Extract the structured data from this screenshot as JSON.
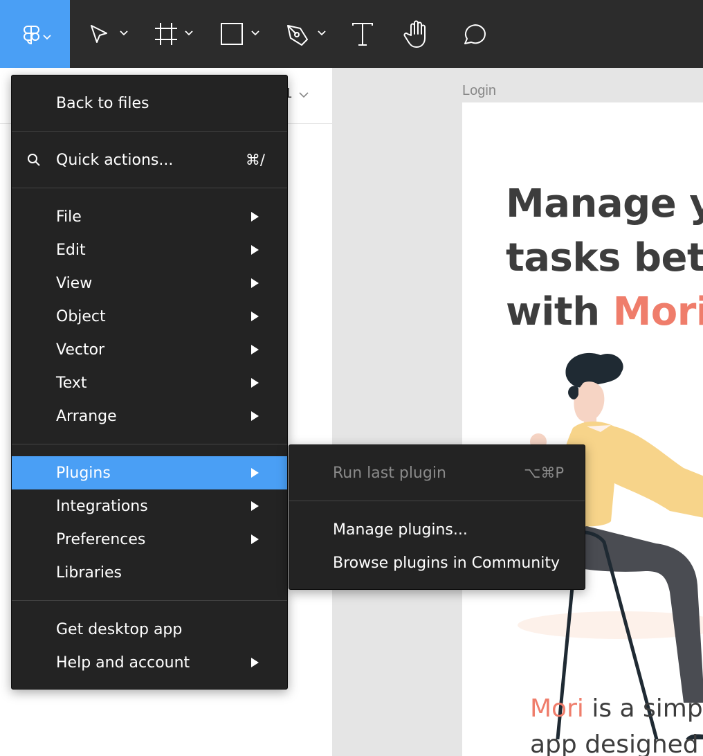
{
  "toolbar": {
    "tools": [
      {
        "name": "figma-menu",
        "icon": "figma-logo-icon"
      },
      {
        "name": "move-tool",
        "icon": "pointer-icon"
      },
      {
        "name": "frame-tool",
        "icon": "frame-icon"
      },
      {
        "name": "shape-tool",
        "icon": "rectangle-icon"
      },
      {
        "name": "pen-tool",
        "icon": "pen-icon"
      },
      {
        "name": "text-tool",
        "icon": "text-icon"
      },
      {
        "name": "hand-tool",
        "icon": "hand-icon"
      },
      {
        "name": "comment-tool",
        "icon": "comment-icon"
      }
    ],
    "accent": "#4a9ff5",
    "background": "#2c2c2c"
  },
  "left_panel": {
    "page_label_partial": "1"
  },
  "canvas": {
    "frame_label": "Login",
    "headline_line1": "Manage yo",
    "headline_line2": "tasks bett",
    "headline_line3_prefix": "with ",
    "headline_line3_accent": "Mori",
    "body_line1_accent": "Mori",
    "body_line1_rest": " is a simp",
    "body_line2": "app designed",
    "accent_color": "#ef7d6b"
  },
  "menu": {
    "back_to_files": "Back to files",
    "quick_actions": "Quick actions...",
    "quick_actions_shortcut": "⌘/",
    "file": "File",
    "edit": "Edit",
    "view": "View",
    "object": "Object",
    "vector": "Vector",
    "text": "Text",
    "arrange": "Arrange",
    "plugins": "Plugins",
    "integrations": "Integrations",
    "preferences": "Preferences",
    "libraries": "Libraries",
    "get_desktop_app": "Get desktop app",
    "help_and_account": "Help and account"
  },
  "submenu": {
    "run_last_plugin": "Run last plugin",
    "run_last_plugin_shortcut": "⌥⌘P",
    "manage_plugins": "Manage plugins...",
    "browse_plugins": "Browse plugins in Community"
  }
}
